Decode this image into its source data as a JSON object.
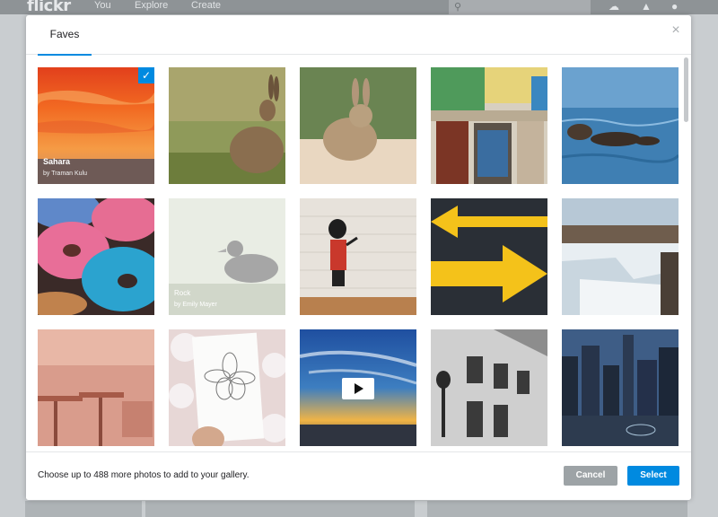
{
  "background": {
    "logo": "flickr",
    "nav": [
      "You",
      "Explore",
      "Create"
    ]
  },
  "modal": {
    "tab": "Faves",
    "close_label": "×",
    "photos": [
      {
        "title": "Sahara",
        "owner": "by Traman Kulu",
        "selected": true,
        "check": "✓"
      },
      {
        "title": "",
        "owner": ""
      },
      {
        "title": "",
        "owner": ""
      },
      {
        "title": "",
        "owner": ""
      },
      {
        "title": "",
        "owner": ""
      },
      {
        "title": "",
        "owner": ""
      },
      {
        "title": "Rock",
        "owner": "by Emily Mayer",
        "faded": true
      },
      {
        "title": "",
        "owner": ""
      },
      {
        "title": "",
        "owner": ""
      },
      {
        "title": "",
        "owner": ""
      },
      {
        "title": "",
        "owner": ""
      },
      {
        "title": "",
        "owner": ""
      },
      {
        "title": "",
        "owner": "",
        "video": true
      },
      {
        "title": "",
        "owner": ""
      },
      {
        "title": "",
        "owner": ""
      }
    ],
    "footer": {
      "message": "Choose up to 488 more photos to add to your gallery.",
      "cancel_label": "Cancel",
      "select_label": "Select"
    }
  },
  "colors": {
    "accent": "#008ae0",
    "cancel": "#9da3a6"
  }
}
